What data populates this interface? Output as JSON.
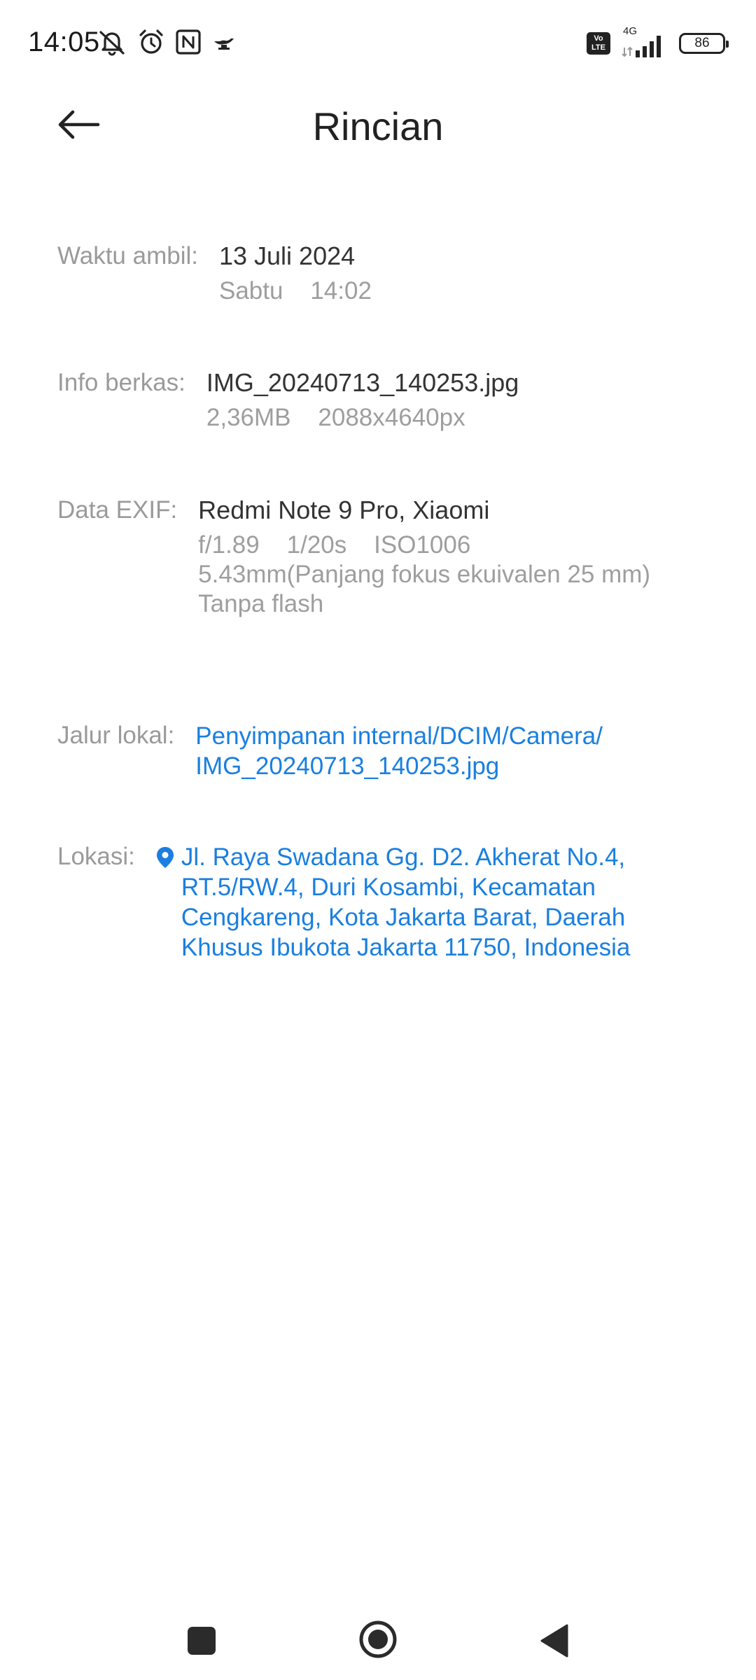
{
  "status": {
    "time": "14:05",
    "volte": "Vo LTE",
    "network": "4G",
    "battery": "86"
  },
  "header": {
    "title": "Rincian"
  },
  "details": {
    "time_label": "Waktu ambil:",
    "date": "13 Juli 2024",
    "day_time": "Sabtu    14:02",
    "file_label": "Info berkas:",
    "file_name": "IMG_20240713_140253.jpg",
    "file_meta": "2,36MB    2088x4640px",
    "exif_label": "Data EXIF:",
    "exif_device": "Redmi Note 9 Pro, Xiaomi",
    "exif_settings": "f/1.89    1/20s    ISO1006",
    "exif_focal": "5.43mm(Panjang fokus ekuivalen 25 mm)",
    "exif_flash": "Tanpa flash",
    "path_label": "Jalur lokal:",
    "path_line1": "Penyimpanan internal/DCIM/Camera/",
    "path_line2": "IMG_20240713_140253.jpg",
    "location_label": "Lokasi:",
    "location_lines": [
      "Jl. Raya Swadana Gg. D2. Akherat No.4,",
      "RT.5/RW.4, Duri Kosambi, Kecamatan",
      "Cengkareng, Kota Jakarta Barat, Daerah",
      "Khusus Ibukota Jakarta 11750, Indonesia"
    ]
  },
  "icons": {
    "back": "arrow-left-icon",
    "pin": "location-pin-icon",
    "status": [
      "mute-bell-icon",
      "alarm-icon",
      "nfc-icon",
      "genie-lamp-icon",
      "signal-icon",
      "battery-icon"
    ],
    "nav": [
      "recents-square-icon",
      "home-circle-icon",
      "back-triangle-icon"
    ]
  },
  "colors": {
    "link": "#1a7fe0",
    "label": "#9a9a9a",
    "primary_text": "#333333"
  }
}
